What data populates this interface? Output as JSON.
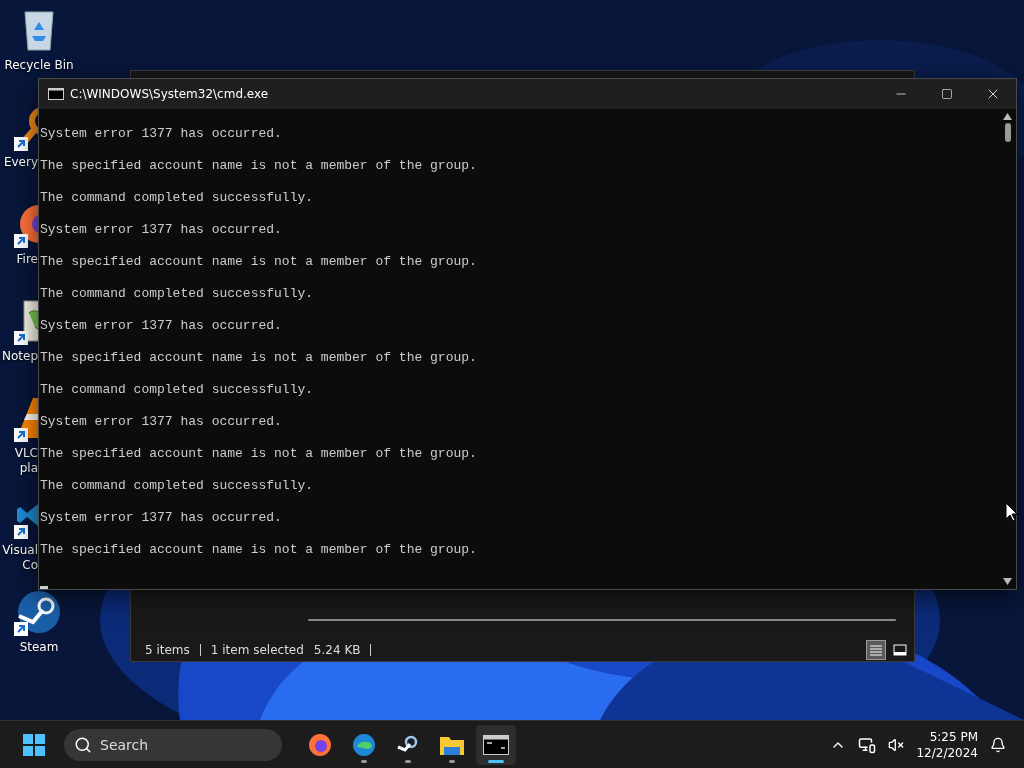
{
  "desktop": {
    "icons": [
      {
        "kind": "recycle",
        "shortcut": false,
        "lines": [
          "Recycle Bin"
        ]
      },
      {
        "kind": "everything",
        "shortcut": true,
        "lines": [
          "Every"
        ]
      },
      {
        "kind": "firefox",
        "shortcut": true,
        "lines": [
          "Fire"
        ]
      },
      {
        "kind": "notepad",
        "shortcut": true,
        "lines": [
          "Notep"
        ]
      },
      {
        "kind": "vlc",
        "shortcut": true,
        "lines": [
          "VLC",
          "pla"
        ]
      },
      {
        "kind": "vscode",
        "shortcut": true,
        "lines": [
          "Visual",
          "Co"
        ]
      },
      {
        "kind": "steam",
        "shortcut": true,
        "lines": [
          "Steam"
        ]
      }
    ]
  },
  "explorer": {
    "status_bar": [
      "5 items",
      "1 item selected",
      "5.24 KB"
    ],
    "views": [
      {
        "kind": "details",
        "selected": true
      },
      {
        "kind": "tiles",
        "selected": false
      }
    ]
  },
  "cmd_window": {
    "title": "C:\\WINDOWS\\System32\\cmd.exe",
    "lines": [
      "System error 1377 has occurred.",
      "The specified account name is not a member of the group.",
      "The command completed successfully.",
      "System error 1377 has occurred.",
      "The specified account name is not a member of the group.",
      "The command completed successfully.",
      "System error 1377 has occurred.",
      "The specified account name is not a member of the group.",
      "The command completed successfully.",
      "System error 1377 has occurred.",
      "The specified account name is not a member of the group.",
      "The command completed successfully.",
      "System error 1377 has occurred.",
      "The specified account name is not a member of the group."
    ]
  },
  "taskbar": {
    "search": {
      "placeholder": "Search"
    },
    "apps": [
      {
        "kind": "firefox",
        "running": false,
        "selected": false
      },
      {
        "kind": "edge",
        "running": true,
        "selected": false
      },
      {
        "kind": "steam",
        "running": true,
        "selected": false
      },
      {
        "kind": "explorer",
        "running": true,
        "selected": false
      },
      {
        "kind": "terminal",
        "running": true,
        "selected": true
      }
    ],
    "clock": {
      "time": "5:25 PM",
      "date": "12/2/2024"
    }
  }
}
